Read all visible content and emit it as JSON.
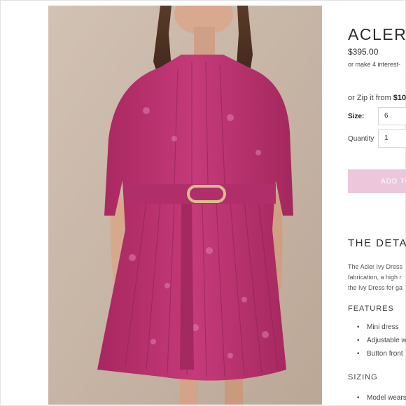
{
  "product": {
    "title": "ACLER I",
    "price": "$395.00",
    "afterpay": "or make 4 interest-",
    "zip_prefix": "or Zip it from ",
    "zip_amount": "$10",
    "size_label": "Size:",
    "size_value": "6",
    "quantity_label": "Quantity",
    "quantity_value": "1",
    "add_button": "ADD TO"
  },
  "details": {
    "heading": "THE DETA",
    "description": [
      "The Acler Ivy Dress",
      "fabrication, a high r",
      "the Ivy Dress for ga"
    ],
    "features_heading": "FEATURES",
    "features": [
      "Mini dress",
      "Adjustable w",
      "Button front"
    ],
    "sizing_heading": "SIZING",
    "sizing": [
      "Model wears"
    ]
  },
  "colors": {
    "dress": "#b8316f",
    "button_bg": "#ecc7dc",
    "backdrop": "#c9b7a8"
  }
}
